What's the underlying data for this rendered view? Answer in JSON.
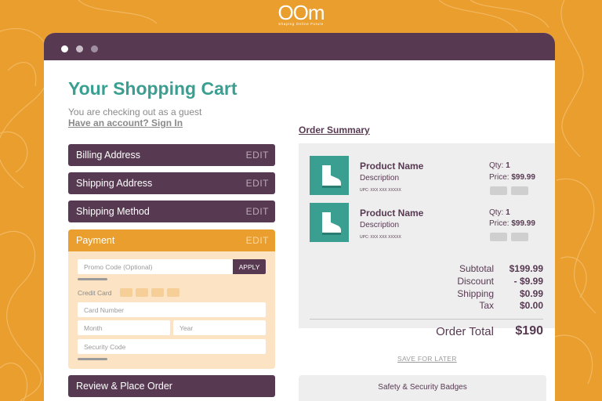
{
  "brand": {
    "logo": "OOm",
    "tagline": "Shaping Online Future"
  },
  "cart": {
    "title": "Your Shopping Cart",
    "guest_text": "You are checking out as a guest",
    "signin_link": "Have an account? Sign In"
  },
  "steps": {
    "billing": "Billing Address",
    "shipping_address": "Shipping Address",
    "shipping_method": "Shipping Method",
    "payment": "Payment",
    "review": "Review & Place Order",
    "edit_label": "EDIT"
  },
  "payment": {
    "promo_placeholder": "Promo Code (Optional)",
    "apply_label": "APPLY",
    "credit_card_label": "Credit Card",
    "card_number_placeholder": "Card Number",
    "month_placeholder": "Month",
    "year_placeholder": "Year",
    "security_placeholder": "Security Code"
  },
  "summary": {
    "title": "Order Summary",
    "products": [
      {
        "name": "Product Name",
        "description": "Description",
        "upc": "UPC: XXX XXX XXXXX",
        "qty_label": "Qty:",
        "qty": "1",
        "price_label": "Price:",
        "price": "$99.99"
      },
      {
        "name": "Product Name",
        "description": "Description",
        "upc": "UPC: XXX XXX XXXXX",
        "qty_label": "Qty:",
        "qty": "1",
        "price_label": "Price:",
        "price": "$99.99"
      }
    ],
    "subtotal_label": "Subtotal",
    "subtotal": "$199.99",
    "discount_label": "Discount",
    "discount": "- $9.99",
    "shipping_label": "Shipping",
    "shipping": "$0.99",
    "tax_label": "Tax",
    "tax": "$0.00",
    "order_total_label": "Order Total",
    "order_total": "$190",
    "save_later": "SAVE FOR LATER",
    "badges": "Safety & Security Badges"
  },
  "colors": {
    "background": "#e99e2e",
    "primary": "#573a52",
    "accent": "#3a9f91",
    "payment_bg": "#fbe3c3"
  },
  "icons": {
    "product": "boot-icon"
  }
}
